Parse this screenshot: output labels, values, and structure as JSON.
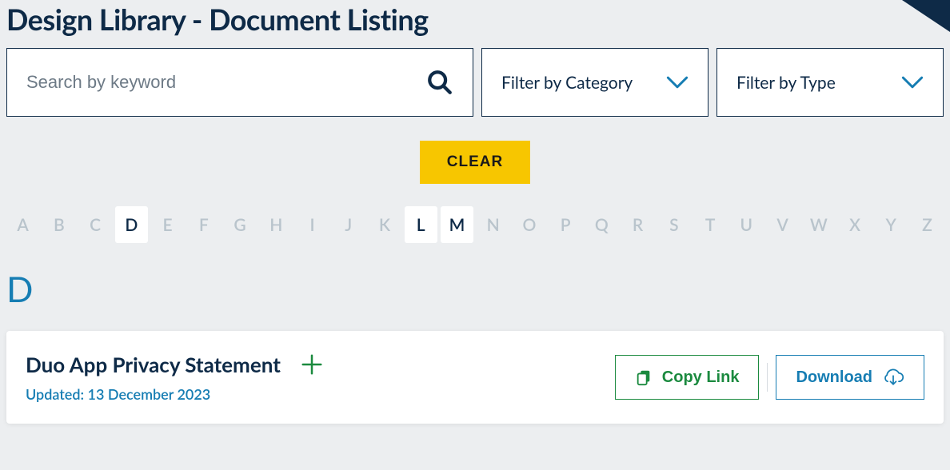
{
  "header": {
    "title": "Design Library - Document Listing"
  },
  "search": {
    "placeholder": "Search by keyword"
  },
  "filters": {
    "category_label": "Filter by Category",
    "type_label": "Filter by Type"
  },
  "clear_label": "CLEAR",
  "alphabet": [
    "A",
    "B",
    "C",
    "D",
    "E",
    "F",
    "G",
    "H",
    "I",
    "J",
    "K",
    "L",
    "M",
    "N",
    "O",
    "P",
    "Q",
    "R",
    "S",
    "T",
    "U",
    "V",
    "W",
    "X",
    "Y",
    "Z"
  ],
  "active_letters": [
    "D",
    "L",
    "M"
  ],
  "section": {
    "letter": "D"
  },
  "document": {
    "title": "Duo App Privacy Statement",
    "updated_label": "Updated: 13 December 2023",
    "copy_label": "Copy Link",
    "download_label": "Download"
  }
}
